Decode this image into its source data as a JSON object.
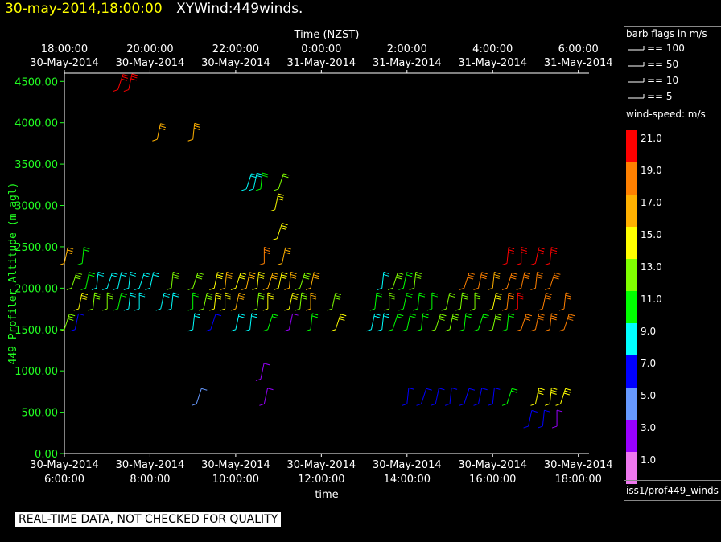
{
  "header": {
    "date": "30-may-2014,18:00:00",
    "name": "XYWind:449winds."
  },
  "colors": {
    "date_text": "#ffff00",
    "ylabel": "#22ff22",
    "yticks": "#22ff22",
    "banner_bg": "#ffffff"
  },
  "legend": {
    "barb_title": "barb flags in m/s",
    "barb_items": [
      {
        "value": "100"
      },
      {
        "value": "50"
      },
      {
        "value": "10"
      },
      {
        "value": "5"
      }
    ],
    "speed_title": "wind-speed: m/s",
    "colorbar": [
      {
        "label": "21.0",
        "color": "#ff0000"
      },
      {
        "label": "19.0",
        "color": "#ff8000"
      },
      {
        "label": "17.0",
        "color": "#ffb000"
      },
      {
        "label": "15.0",
        "color": "#ffff00"
      },
      {
        "label": "13.0",
        "color": "#80ff00"
      },
      {
        "label": "11.0",
        "color": "#00ff00"
      },
      {
        "label": "9.0",
        "color": "#00ffff"
      },
      {
        "label": "7.0",
        "color": "#0000ff"
      },
      {
        "label": "5.0",
        "color": "#6699ff"
      },
      {
        "label": "3.0",
        "color": "#9900ff"
      },
      {
        "label": "1.0",
        "color": "#ee77ee"
      }
    ],
    "source": "iss1/prof449_winds"
  },
  "banner": "REAL-TIME DATA, NOT CHECKED FOR QUALITY",
  "chart_data": {
    "type": "scatter",
    "title": "",
    "top_axis_title": "Time (NZST)",
    "top_ticks": [
      [
        "18:00:00",
        "30-May-2014"
      ],
      [
        "20:00:00",
        "30-May-2014"
      ],
      [
        "22:00:00",
        "30-May-2014"
      ],
      [
        "0:00:00",
        "31-May-2014"
      ],
      [
        "2:00:00",
        "31-May-2014"
      ],
      [
        "4:00:00",
        "31-May-2014"
      ],
      [
        "6:00:00",
        "31-May-2014"
      ]
    ],
    "bottom_ticks": [
      [
        "30-May-2014",
        "6:00:00"
      ],
      [
        "30-May-2014",
        "8:00:00"
      ],
      [
        "30-May-2014",
        "10:00:00"
      ],
      [
        "30-May-2014",
        "12:00:00"
      ],
      [
        "30-May-2014",
        "14:00:00"
      ],
      [
        "30-May-2014",
        "16:00:00"
      ],
      [
        "30-May-2014",
        "18:00:00"
      ]
    ],
    "xlabel": "time",
    "ylabel": "449 Profiler Altitude (m agl)",
    "x_range": [
      "2014-05-30T06:00",
      "2014-05-30T18:15"
    ],
    "ylim": [
      0,
      4600
    ],
    "yticks": [
      "0.00",
      "500.00",
      "1000.00",
      "1500.00",
      "2000.00",
      "2500.00",
      "3000.00",
      "3500.00",
      "4000.00",
      "4500.00"
    ],
    "series": [
      {
        "altitude": 4400,
        "points": [
          {
            "x": "2014-05-30T07:15",
            "speed": 21
          },
          {
            "x": "2014-05-30T07:30",
            "speed": 21
          }
        ]
      },
      {
        "altitude": 3800,
        "points": [
          {
            "x": "2014-05-30T08:10",
            "speed": 17
          },
          {
            "x": "2014-05-30T09:00",
            "speed": 17
          }
        ]
      },
      {
        "altitude": 3200,
        "points": [
          {
            "x": "2014-05-30T10:15",
            "speed": 9
          },
          {
            "x": "2014-05-30T10:25",
            "speed": 9
          },
          {
            "x": "2014-05-30T10:35",
            "speed": 11
          },
          {
            "x": "2014-05-30T11:00",
            "speed": 12
          }
        ]
      },
      {
        "altitude": 2950,
        "points": [
          {
            "x": "2014-05-30T10:55",
            "speed": 15
          }
        ]
      },
      {
        "altitude": 2600,
        "points": [
          {
            "x": "2014-05-30T10:58",
            "speed": 15
          }
        ]
      },
      {
        "altitude": 2300,
        "points": [
          {
            "x": "2014-05-30T06:00",
            "speed": 17
          },
          {
            "x": "2014-05-30T06:25",
            "speed": 11
          },
          {
            "x": "2014-05-30T10:40",
            "speed": 19
          },
          {
            "x": "2014-05-30T11:05",
            "speed": 17
          },
          {
            "x": "2014-05-30T16:20",
            "speed": 21
          },
          {
            "x": "2014-05-30T16:40",
            "speed": 21
          },
          {
            "x": "2014-05-30T17:00",
            "speed": 20
          },
          {
            "x": "2014-05-30T17:20",
            "speed": 21
          }
        ]
      },
      {
        "altitude": 2000,
        "points": [
          {
            "x": "2014-05-30T06:10",
            "speed": 13
          },
          {
            "x": "2014-05-30T06:30",
            "speed": 11
          },
          {
            "x": "2014-05-30T06:45",
            "speed": 9
          },
          {
            "x": "2014-05-30T07:00",
            "speed": 9
          },
          {
            "x": "2014-05-30T07:15",
            "speed": 9
          },
          {
            "x": "2014-05-30T07:30",
            "speed": 9
          },
          {
            "x": "2014-05-30T07:45",
            "speed": 9
          },
          {
            "x": "2014-05-30T08:00",
            "speed": 9
          },
          {
            "x": "2014-05-30T08:30",
            "speed": 13
          },
          {
            "x": "2014-05-30T09:00",
            "speed": 13
          },
          {
            "x": "2014-05-30T09:30",
            "speed": 15
          },
          {
            "x": "2014-05-30T09:45",
            "speed": 17
          },
          {
            "x": "2014-05-30T10:00",
            "speed": 15
          },
          {
            "x": "2014-05-30T10:15",
            "speed": 17
          },
          {
            "x": "2014-05-30T10:30",
            "speed": 15
          },
          {
            "x": "2014-05-30T10:45",
            "speed": 17
          },
          {
            "x": "2014-05-30T11:00",
            "speed": 15
          },
          {
            "x": "2014-05-30T11:15",
            "speed": 17
          },
          {
            "x": "2014-05-30T11:30",
            "speed": 13
          },
          {
            "x": "2014-05-30T11:45",
            "speed": 17
          },
          {
            "x": "2014-05-30T13:25",
            "speed": 9
          },
          {
            "x": "2014-05-30T13:40",
            "speed": 13
          },
          {
            "x": "2014-05-30T13:55",
            "speed": 11
          },
          {
            "x": "2014-05-30T14:10",
            "speed": 13
          },
          {
            "x": "2014-05-30T15:20",
            "speed": 19
          },
          {
            "x": "2014-05-30T15:40",
            "speed": 19
          },
          {
            "x": "2014-05-30T16:00",
            "speed": 17
          },
          {
            "x": "2014-05-30T16:20",
            "speed": 19
          },
          {
            "x": "2014-05-30T16:40",
            "speed": 19
          },
          {
            "x": "2014-05-30T17:00",
            "speed": 19
          },
          {
            "x": "2014-05-30T17:20",
            "speed": 19
          }
        ]
      },
      {
        "altitude": 1750,
        "points": [
          {
            "x": "2014-05-30T06:20",
            "speed": 15
          },
          {
            "x": "2014-05-30T06:40",
            "speed": 13
          },
          {
            "x": "2014-05-30T07:00",
            "speed": 13
          },
          {
            "x": "2014-05-30T07:15",
            "speed": 11
          },
          {
            "x": "2014-05-30T07:30",
            "speed": 9
          },
          {
            "x": "2014-05-30T07:45",
            "speed": 9
          },
          {
            "x": "2014-05-30T08:15",
            "speed": 9
          },
          {
            "x": "2014-05-30T08:30",
            "speed": 9
          },
          {
            "x": "2014-05-30T09:00",
            "speed": 11
          },
          {
            "x": "2014-05-30T09:15",
            "speed": 13
          },
          {
            "x": "2014-05-30T09:30",
            "speed": 15
          },
          {
            "x": "2014-05-30T09:45",
            "speed": 15
          },
          {
            "x": "2014-05-30T10:00",
            "speed": 17
          },
          {
            "x": "2014-05-30T10:30",
            "speed": 13
          },
          {
            "x": "2014-05-30T10:45",
            "speed": 15
          },
          {
            "x": "2014-05-30T11:15",
            "speed": 15
          },
          {
            "x": "2014-05-30T11:30",
            "speed": 13
          },
          {
            "x": "2014-05-30T11:45",
            "speed": 17
          },
          {
            "x": "2014-05-30T12:15",
            "speed": 13
          },
          {
            "x": "2014-05-30T13:15",
            "speed": 11
          },
          {
            "x": "2014-05-30T13:35",
            "speed": 13
          },
          {
            "x": "2014-05-30T13:55",
            "speed": 11
          },
          {
            "x": "2014-05-30T14:15",
            "speed": 11
          },
          {
            "x": "2014-05-30T14:35",
            "speed": 11
          },
          {
            "x": "2014-05-30T14:55",
            "speed": 12
          },
          {
            "x": "2014-05-30T15:15",
            "speed": 13
          },
          {
            "x": "2014-05-30T15:35",
            "speed": 13
          },
          {
            "x": "2014-05-30T16:00",
            "speed": 15
          },
          {
            "x": "2014-05-30T16:20",
            "speed": 19
          },
          {
            "x": "2014-05-30T16:35",
            "speed": 21
          },
          {
            "x": "2014-05-30T17:10",
            "speed": 19
          },
          {
            "x": "2014-05-30T17:40",
            "speed": 19
          }
        ]
      },
      {
        "altitude": 1500,
        "points": [
          {
            "x": "2014-05-30T06:00",
            "speed": 13
          },
          {
            "x": "2014-05-30T06:15",
            "speed": 7
          },
          {
            "x": "2014-05-30T09:00",
            "speed": 9
          },
          {
            "x": "2014-05-30T09:25",
            "speed": 7
          },
          {
            "x": "2014-05-30T10:00",
            "speed": 9
          },
          {
            "x": "2014-05-30T10:20",
            "speed": 9
          },
          {
            "x": "2014-05-30T10:45",
            "speed": 11
          },
          {
            "x": "2014-05-30T11:15",
            "speed": 3
          },
          {
            "x": "2014-05-30T11:45",
            "speed": 11
          },
          {
            "x": "2014-05-30T12:20",
            "speed": 15
          },
          {
            "x": "2014-05-30T13:10",
            "speed": 9
          },
          {
            "x": "2014-05-30T13:25",
            "speed": 9
          },
          {
            "x": "2014-05-30T13:40",
            "speed": 11
          },
          {
            "x": "2014-05-30T14:00",
            "speed": 11
          },
          {
            "x": "2014-05-30T14:20",
            "speed": 11
          },
          {
            "x": "2014-05-30T14:40",
            "speed": 13
          },
          {
            "x": "2014-05-30T15:00",
            "speed": 13
          },
          {
            "x": "2014-05-30T15:20",
            "speed": 11
          },
          {
            "x": "2014-05-30T15:40",
            "speed": 11
          },
          {
            "x": "2014-05-30T16:00",
            "speed": 13
          },
          {
            "x": "2014-05-30T16:20",
            "speed": 11
          },
          {
            "x": "2014-05-30T16:40",
            "speed": 19
          },
          {
            "x": "2014-05-30T17:00",
            "speed": 19
          },
          {
            "x": "2014-05-30T17:20",
            "speed": 19
          },
          {
            "x": "2014-05-30T17:40",
            "speed": 19
          }
        ]
      },
      {
        "altitude": 900,
        "points": [
          {
            "x": "2014-05-30T10:35",
            "speed": 3
          }
        ]
      },
      {
        "altitude": 600,
        "points": [
          {
            "x": "2014-05-30T09:05",
            "speed": 5
          },
          {
            "x": "2014-05-30T10:40",
            "speed": 3
          },
          {
            "x": "2014-05-30T14:00",
            "speed": 7
          },
          {
            "x": "2014-05-30T14:20",
            "speed": 7
          },
          {
            "x": "2014-05-30T14:40",
            "speed": 7
          },
          {
            "x": "2014-05-30T15:00",
            "speed": 7
          },
          {
            "x": "2014-05-30T15:20",
            "speed": 7
          },
          {
            "x": "2014-05-30T15:40",
            "speed": 7
          },
          {
            "x": "2014-05-30T16:00",
            "speed": 7
          },
          {
            "x": "2014-05-30T16:20",
            "speed": 11
          },
          {
            "x": "2014-05-30T17:00",
            "speed": 15
          },
          {
            "x": "2014-05-30T17:20",
            "speed": 15
          },
          {
            "x": "2014-05-30T17:35",
            "speed": 15
          }
        ]
      },
      {
        "altitude": 330,
        "points": [
          {
            "x": "2014-05-30T16:50",
            "speed": 7
          },
          {
            "x": "2014-05-30T17:10",
            "speed": 7
          },
          {
            "x": "2014-05-30T17:30",
            "speed": 3
          }
        ]
      }
    ]
  }
}
